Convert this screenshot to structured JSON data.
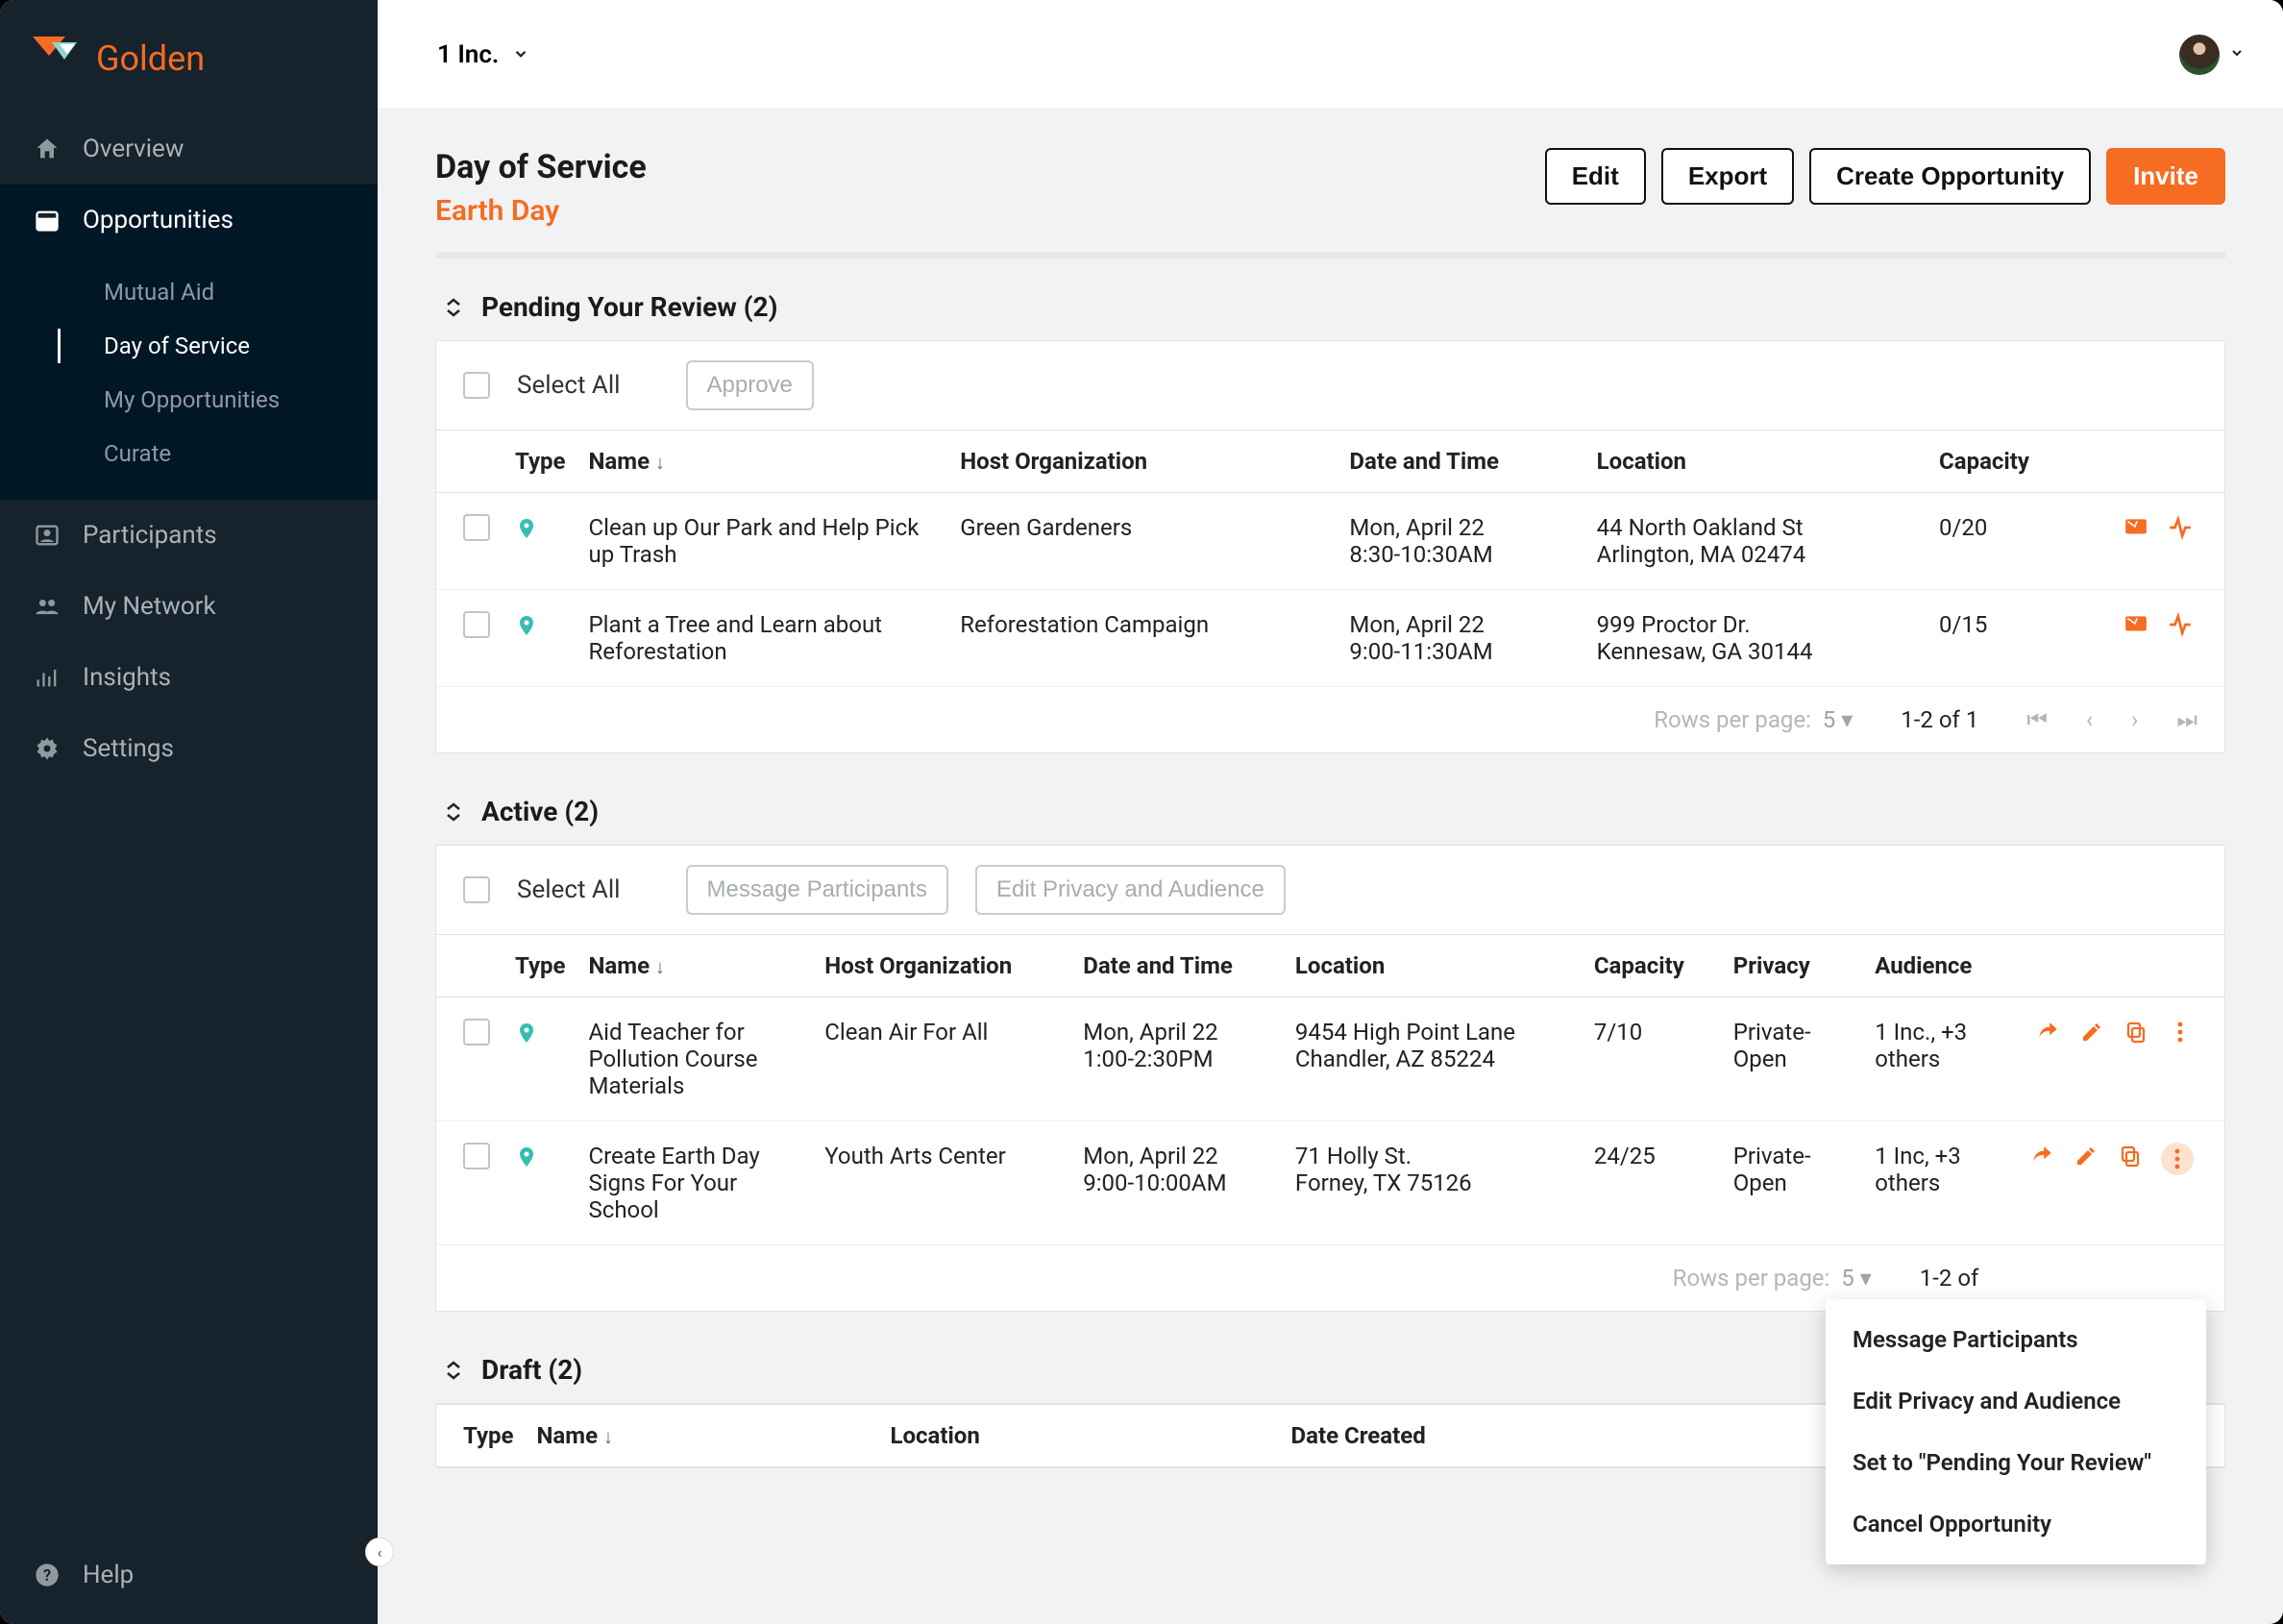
{
  "brand": {
    "name": "Golden"
  },
  "topbar": {
    "org": "1 Inc."
  },
  "sidebar": {
    "overview": "Overview",
    "opportunities": "Opportunities",
    "sub": {
      "mutual_aid": "Mutual Aid",
      "day_of_service": "Day of Service",
      "my_opportunities": "My Opportunities",
      "curate": "Curate"
    },
    "participants": "Participants",
    "my_network": "My Network",
    "insights": "Insights",
    "settings": "Settings",
    "help": "Help"
  },
  "page": {
    "title": "Day of Service",
    "subtitle": "Earth Day",
    "buttons": {
      "edit": "Edit",
      "export": "Export",
      "create": "Create Opportunity",
      "invite": "Invite"
    }
  },
  "pending": {
    "title": "Pending Your Review (2)",
    "select_all": "Select All",
    "approve": "Approve",
    "headers": {
      "type": "Type",
      "name": "Name",
      "host": "Host Organization",
      "datetime": "Date and Time",
      "location": "Location",
      "capacity": "Capacity"
    },
    "rows": [
      {
        "name": "Clean up Our Park and Help Pick up Trash",
        "host": "Green Gardeners",
        "date_l1": "Mon, April 22",
        "date_l2": "8:30-10:30AM",
        "loc_l1": "44 North Oakland St",
        "loc_l2": "Arlington, MA 02474",
        "capacity": "0/20"
      },
      {
        "name": "Plant a Tree and Learn about Reforestation",
        "host": "Reforestation Campaign",
        "date_l1": "Mon, April 22",
        "date_l2": "9:00-11:30AM",
        "loc_l1": "999 Proctor Dr.",
        "loc_l2": "Kennesaw, GA 30144",
        "capacity": "0/15"
      }
    ],
    "pager": {
      "rpp_label": "Rows per page:",
      "rpp_value": "5",
      "range": "1-2 of 1"
    }
  },
  "active": {
    "title": "Active (2)",
    "select_all": "Select All",
    "msg_btn": "Message Participants",
    "priv_btn": "Edit Privacy and Audience",
    "headers": {
      "type": "Type",
      "name": "Name",
      "host": "Host Organization",
      "datetime": "Date and Time",
      "location": "Location",
      "capacity": "Capacity",
      "privacy": "Privacy",
      "audience": "Audience"
    },
    "rows": [
      {
        "name": "Aid Teacher for Pollution Course Materials",
        "host": "Clean Air For All",
        "date_l1": "Mon, April 22",
        "date_l2": "1:00-2:30PM",
        "loc_l1": "9454 High Point Lane",
        "loc_l2": "Chandler, AZ 85224",
        "capacity": "7/10",
        "privacy": "Private-Open",
        "audience": "1 Inc., +3 others"
      },
      {
        "name": "Create Earth Day Signs For Your School",
        "host": "Youth Arts Center",
        "date_l1": "Mon, April 22",
        "date_l2": "9:00-10:00AM",
        "loc_l1": "71 Holly St.",
        "loc_l2": "Forney, TX 75126",
        "capacity": "24/25",
        "privacy": "Private-Open",
        "audience": "1 Inc, +3 others"
      }
    ],
    "pager": {
      "rpp_label": "Rows per page:",
      "rpp_value": "5",
      "range": "1-2 of"
    }
  },
  "draft": {
    "title": "Draft (2)",
    "headers": {
      "type": "Type",
      "name": "Name",
      "location": "Location",
      "date_created": "Date Created"
    }
  },
  "context_menu": {
    "msg": "Message Participants",
    "priv": "Edit Privacy and Audience",
    "pending": "Set to \"Pending Your Review\"",
    "cancel": "Cancel Opportunity"
  }
}
